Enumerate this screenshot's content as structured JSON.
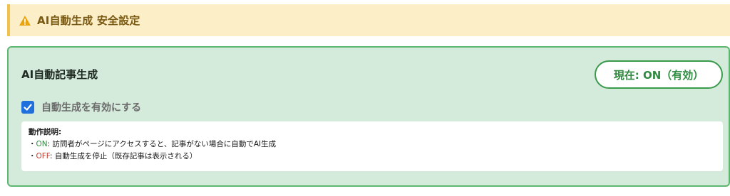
{
  "banner": {
    "icon": "warning-icon",
    "title": "AI自動生成 安全設定",
    "colors": {
      "background": "#fcefc8",
      "accent": "#f0c24b",
      "text": "#7a5a12"
    }
  },
  "panel": {
    "title": "AI自動記事生成",
    "status_badge": "現在: ON（有効）",
    "checkbox": {
      "label": "自動生成を有効にする",
      "checked": true
    },
    "description": {
      "title": "動作説明:",
      "items": [
        {
          "bullet": "・",
          "key": "ON",
          "sep": ": ",
          "text": "訪問者がページにアクセスすると、記事がない場合に自動でAI生成"
        },
        {
          "bullet": "・",
          "key": "OFF",
          "sep": ": ",
          "text": "自動生成を停止（既存記事は表示される）"
        }
      ]
    },
    "colors": {
      "background": "#d4eadb",
      "border": "#5db56f",
      "on": "#2e8b3f",
      "off": "#c0392b",
      "checkbox": "#1f6fdc"
    }
  }
}
